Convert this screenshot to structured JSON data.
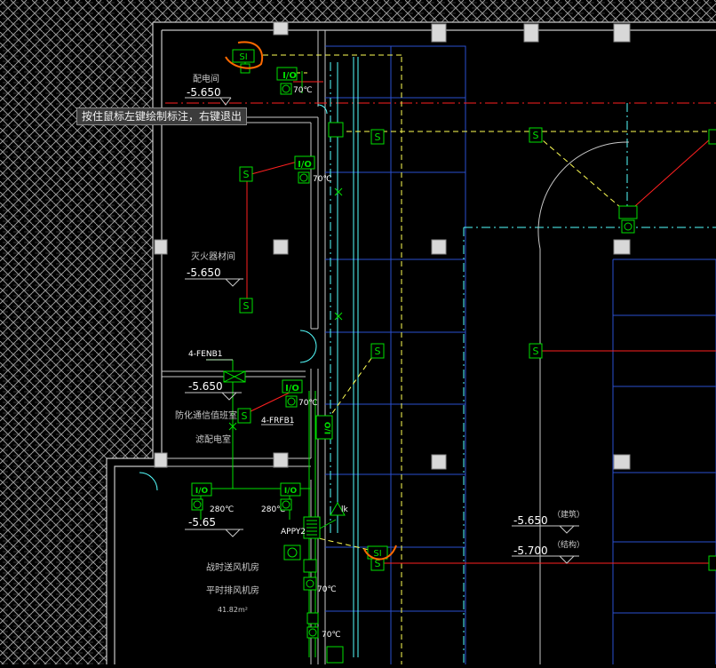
{
  "tooltip": "按住鼠标左键绘制标注，右键退出",
  "rooms": {
    "distribution_room": {
      "name": "配电间",
      "elev": "-5.650"
    },
    "extinguish_room": {
      "name": "灭火器材间",
      "elev": "-5.650"
    },
    "telecom_room": {
      "name": "防化通信值班室",
      "name2": "滤配电室",
      "elev": "-5.650"
    },
    "fan_room": {
      "name": "战时送风机房",
      "name2": "平时排风机房",
      "area": "41.82m²",
      "elev": "-5.65"
    }
  },
  "labels": {
    "fen_b1": "4-FENB1",
    "frfb1": "4-FRFB1",
    "appy2": "APPY2",
    "t70": "70℃",
    "t280": "280℃",
    "io": "I/O",
    "s": "S",
    "si": "SI",
    "lk": "lk"
  },
  "elevations": {
    "arch": {
      "value": "-5.650",
      "note": "（建筑）"
    },
    "struct": {
      "value": "-5.700",
      "note": "（结构）"
    }
  },
  "colors": {
    "background": "#000000",
    "wall": "#c8c8c8",
    "green": "#00e000",
    "yellow": "#ffff55",
    "red": "#ff2020",
    "cyan": "#55ffff",
    "blue": "#2a4fd0",
    "orange": "#ff6a00",
    "text": "#c8c8c8"
  }
}
